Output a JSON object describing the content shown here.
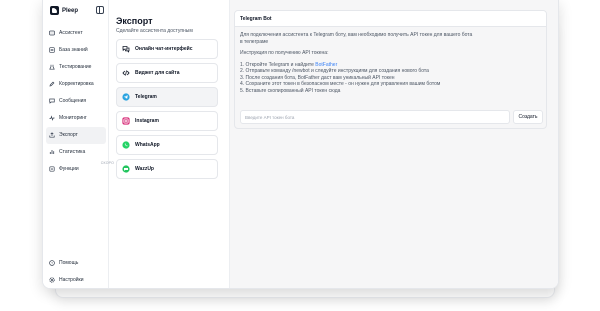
{
  "brand": {
    "name": "Pleep"
  },
  "sidebar": {
    "items": [
      {
        "label": "Ассистент",
        "icon": "assistant-icon"
      },
      {
        "label": "База знаний",
        "icon": "knowledge-base-icon"
      },
      {
        "label": "Тестирование",
        "icon": "testing-icon"
      },
      {
        "label": "Корректировка",
        "icon": "edit-icon"
      },
      {
        "label": "Сообщения",
        "icon": "messages-icon"
      },
      {
        "label": "Мониторинг",
        "icon": "monitoring-icon"
      },
      {
        "label": "Экспорт",
        "icon": "export-icon",
        "active": true
      },
      {
        "label": "Статистика",
        "icon": "statistics-icon"
      },
      {
        "label": "Функции",
        "icon": "functions-icon",
        "badge": "СКОРО"
      }
    ],
    "bottom": [
      {
        "label": "Помощь",
        "icon": "help-icon"
      },
      {
        "label": "Настройки",
        "icon": "settings-icon"
      }
    ]
  },
  "export": {
    "title": "Экспорт",
    "subtitle": "Сделайте ассистента доступным",
    "options": [
      {
        "label": "Онлайн чат-интерфейс",
        "icon": "chat-icon"
      },
      {
        "label": "Виджет для сайта",
        "icon": "code-icon"
      },
      {
        "label": "Telegram",
        "icon": "telegram-icon",
        "active": true
      },
      {
        "label": "Instagram",
        "icon": "instagram-icon"
      },
      {
        "label": "WhatsApp",
        "icon": "whatsapp-icon"
      },
      {
        "label": "WazzUp",
        "icon": "wazzup-icon"
      }
    ]
  },
  "telegram": {
    "title": "Telegram Bot",
    "intro_line1": "Для подключения ассистента к Telegram боту, вам необходимо получить API токен для вашего бота",
    "intro_line2": "в телеграме",
    "instructions_title": "Инструкция по получению API токена:",
    "step1_prefix": "1. Откройте Telegram и найдите ",
    "step1_link": "BotFather",
    "step2": "2. Отправьте команду /newbot и следуйте инструкциям для создания нового бота",
    "step3": "3. После создания бота, BotFather даст вам уникальный API токен",
    "step4": "4. Сохраните этот токен в безопасном месте - он нужен для управления вашим ботом",
    "step5": "5. Вставьте скопированный API токен сюда",
    "token_placeholder": "Введите API токен бота",
    "create_label": "Создать"
  },
  "colors": {
    "accent_link": "#3b82f6",
    "telegram": "#2aa3e0",
    "instagram": "#d62976",
    "whatsapp": "#25d366",
    "wazzup": "#22c55e"
  }
}
